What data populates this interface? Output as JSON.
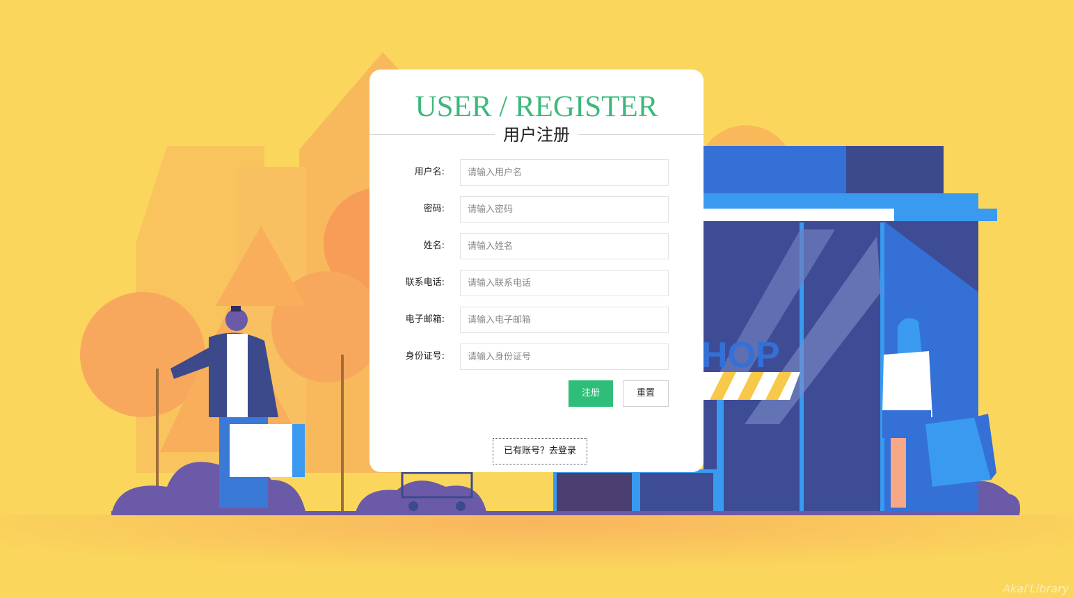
{
  "header": {
    "title_en": "USER / REGISTER",
    "title_cn": "用户注册"
  },
  "form": {
    "fields": [
      {
        "label": "用户名:",
        "placeholder": "请输入用户名",
        "value": ""
      },
      {
        "label": "密码:",
        "placeholder": "请输入密码",
        "value": ""
      },
      {
        "label": "姓名:",
        "placeholder": "请输入姓名",
        "value": ""
      },
      {
        "label": "联系电话:",
        "placeholder": "请输入联系电话",
        "value": ""
      },
      {
        "label": "电子邮箱:",
        "placeholder": "请输入电子邮箱",
        "value": ""
      },
      {
        "label": "身份证号:",
        "placeholder": "请输入身份证号",
        "value": ""
      }
    ],
    "submit_label": "注册",
    "reset_label": "重置",
    "login_link": "已有账号？去登录"
  },
  "background": {
    "shop_sign": "HOP",
    "watermark": "Akai'Library"
  },
  "colors": {
    "accent": "#3cb87c",
    "button": "#2fbe79",
    "background": "#fad75c",
    "shop_blue": "#3b6fd6"
  }
}
